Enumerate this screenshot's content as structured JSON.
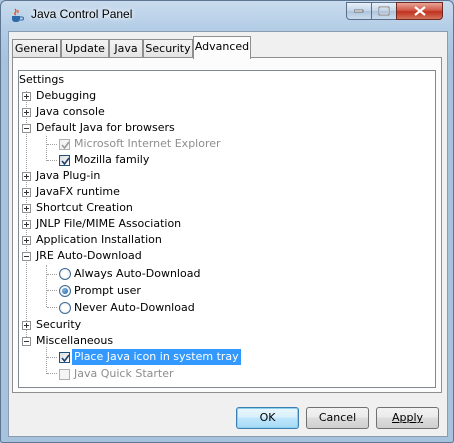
{
  "window": {
    "title": "Java Control Panel",
    "icon": "java-cup-icon"
  },
  "tabs": [
    {
      "label": "General",
      "active": false
    },
    {
      "label": "Update",
      "active": false
    },
    {
      "label": "Java",
      "active": false
    },
    {
      "label": "Security",
      "active": false
    },
    {
      "label": "Advanced",
      "active": true
    }
  ],
  "tree": {
    "root": "Settings",
    "debugging": "Debugging",
    "java_console": "Java console",
    "default_java_browsers": "Default Java for browsers",
    "ie": {
      "label": "Microsoft Internet Explorer",
      "checked": true,
      "enabled": false
    },
    "mozilla": {
      "label": "Mozilla family",
      "checked": true,
      "enabled": true
    },
    "java_plugin": "Java Plug-in",
    "javafx_runtime": "JavaFX runtime",
    "shortcut_creation": "Shortcut Creation",
    "jnlp_mime": "JNLP File/MIME Association",
    "app_install": "Application Installation",
    "jre_auto_download": "JRE Auto-Download",
    "always_auto_download": {
      "label": "Always Auto-Download",
      "selected": false
    },
    "prompt_user": {
      "label": "Prompt user",
      "selected": true
    },
    "never_auto_download": {
      "label": "Never Auto-Download",
      "selected": false
    },
    "security": "Security",
    "miscellaneous": "Miscellaneous",
    "java_icon_tray": {
      "label": "Place Java icon in system tray",
      "checked": true,
      "selected": true
    },
    "java_quick_starter": {
      "label": "Java Quick Starter",
      "checked": false,
      "enabled": false
    }
  },
  "buttons": {
    "ok": "OK",
    "cancel": "Cancel",
    "apply": "Apply"
  },
  "colors": {
    "selection": "#3399ff",
    "accent": "#3c7fb1"
  }
}
